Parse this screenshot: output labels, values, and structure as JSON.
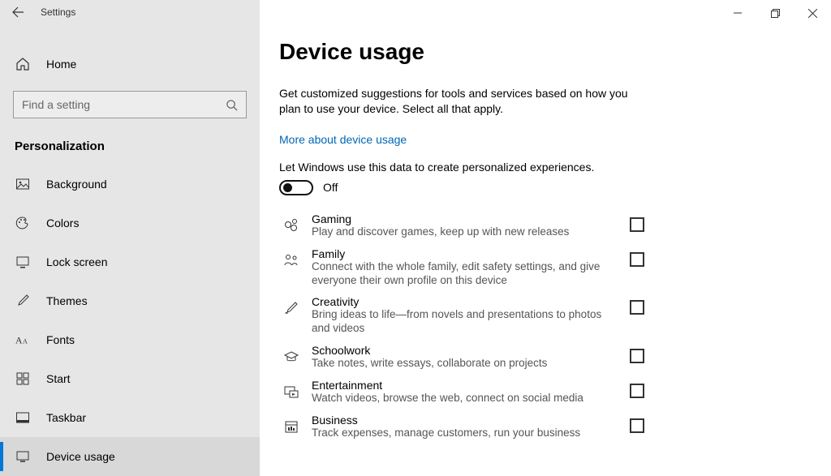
{
  "app_title": "Settings",
  "home_label": "Home",
  "search_placeholder": "Find a setting",
  "category": "Personalization",
  "nav": [
    {
      "label": "Background"
    },
    {
      "label": "Colors"
    },
    {
      "label": "Lock screen"
    },
    {
      "label": "Themes"
    },
    {
      "label": "Fonts"
    },
    {
      "label": "Start"
    },
    {
      "label": "Taskbar"
    },
    {
      "label": "Device usage"
    }
  ],
  "page": {
    "title": "Device usage",
    "description": "Get customized suggestions for tools and services based on how you plan to use your device. Select all that apply.",
    "link": "More about device usage",
    "toggle_caption": "Let Windows use this data to create personalized experiences.",
    "toggle_state": "Off"
  },
  "usage": [
    {
      "title": "Gaming",
      "sub": "Play and discover games, keep up with new releases"
    },
    {
      "title": "Family",
      "sub": "Connect with the whole family, edit safety settings, and give everyone their own profile on this device"
    },
    {
      "title": "Creativity",
      "sub": "Bring ideas to life—from novels and presentations to photos and videos"
    },
    {
      "title": "Schoolwork",
      "sub": "Take notes, write essays, collaborate on projects"
    },
    {
      "title": "Entertainment",
      "sub": "Watch videos, browse the web, connect on social media"
    },
    {
      "title": "Business",
      "sub": "Track expenses, manage customers, run your business"
    }
  ]
}
